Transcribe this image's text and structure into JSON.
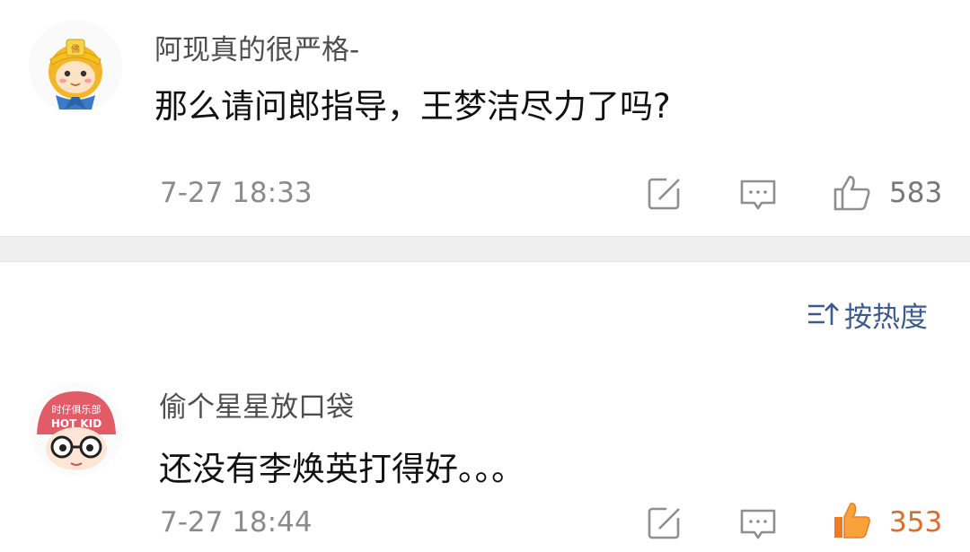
{
  "comments": [
    {
      "username": "阿现真的很严格-",
      "text": "那么请问郎指导，王梦洁尽力了吗?",
      "time": "7-27 18:33",
      "likes": "583",
      "liked": false
    },
    {
      "username": "偷个星星放口袋",
      "text": "还没有李焕英打得好。。。",
      "time": "7-27 18:44",
      "likes": "353",
      "liked": true,
      "avatar_text": "时仔俱乐部 HOT KID"
    }
  ],
  "sort": {
    "label": "按热度",
    "icon": "sort-icon"
  },
  "colors": {
    "link": "#3a5a92",
    "liked": "#f07a24",
    "muted": "#8b8b8b"
  }
}
